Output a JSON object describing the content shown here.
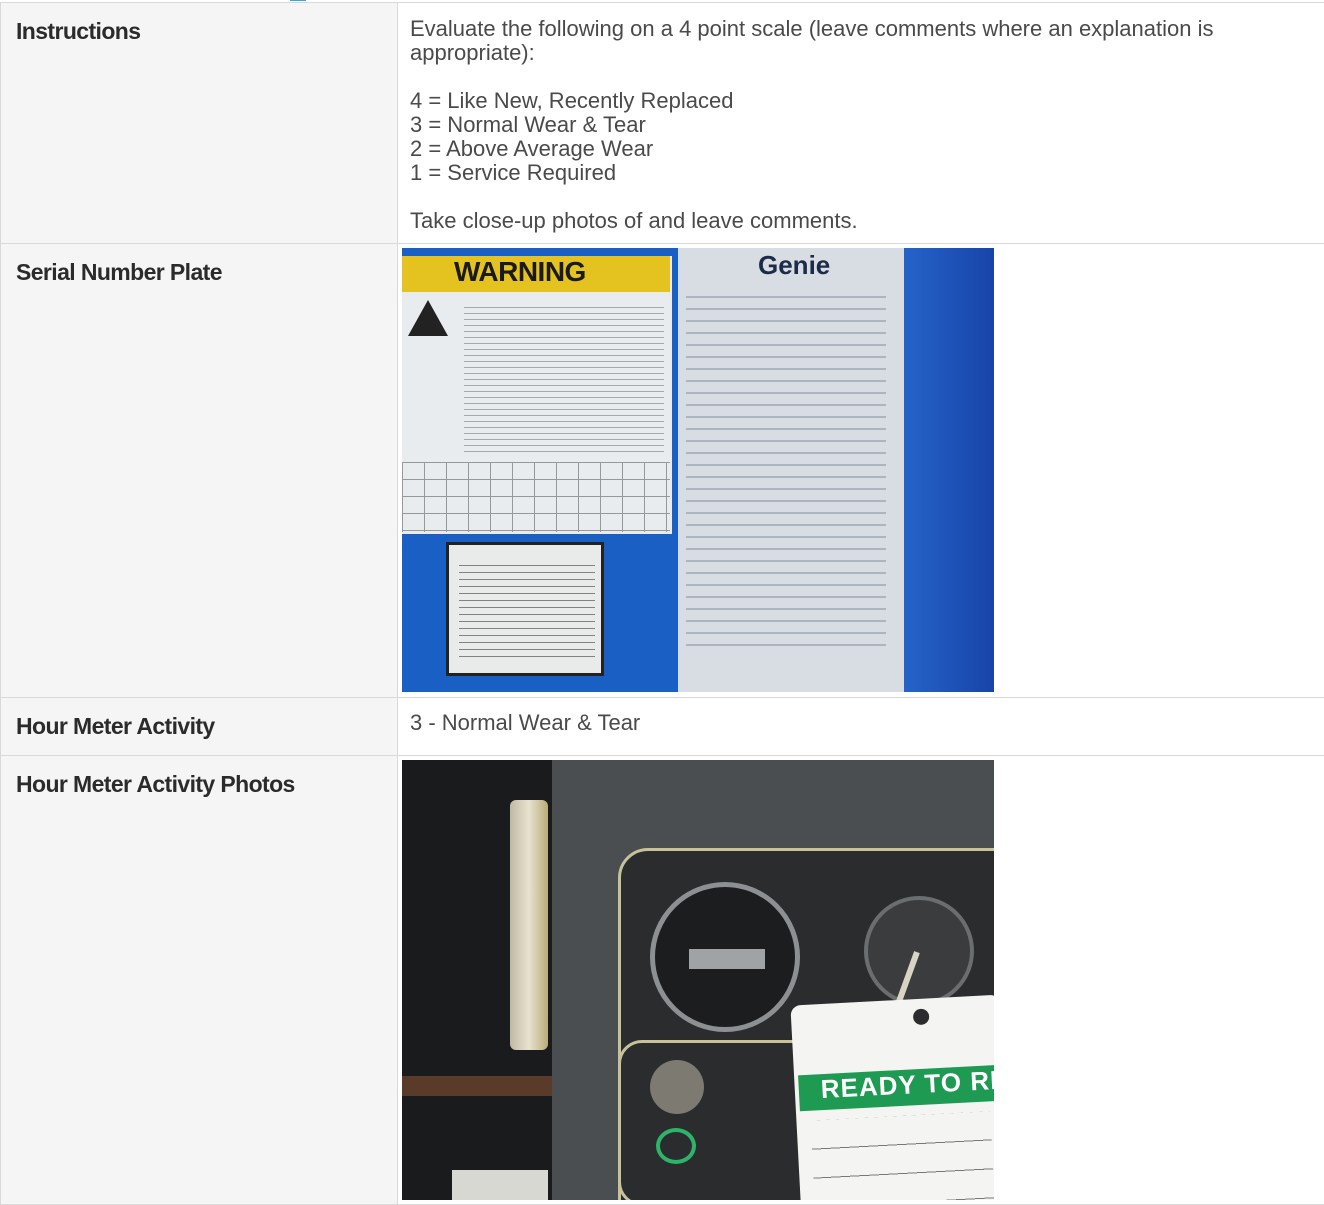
{
  "rows": [
    {
      "label": "Instructions",
      "paragraphs": [
        "Evaluate the following on a 4 point scale (leave comments where an explanation is appropriate):"
      ],
      "scale": [
        "4 = Like New, Recently Replaced",
        "3 = Normal Wear & Tear",
        "2 = Above Average Wear",
        "1 = Service Required"
      ],
      "closing": "Take close-up photos of and leave comments."
    },
    {
      "label": "Serial Number Plate",
      "photo": {
        "warning_text": "WARNING",
        "brand_text": "Genie"
      }
    },
    {
      "label": "Hour Meter Activity",
      "value": "3 - Normal Wear & Tear"
    },
    {
      "label": "Hour Meter Activity Photos",
      "photo": {
        "tag_text": "READY TO RENT"
      }
    }
  ]
}
